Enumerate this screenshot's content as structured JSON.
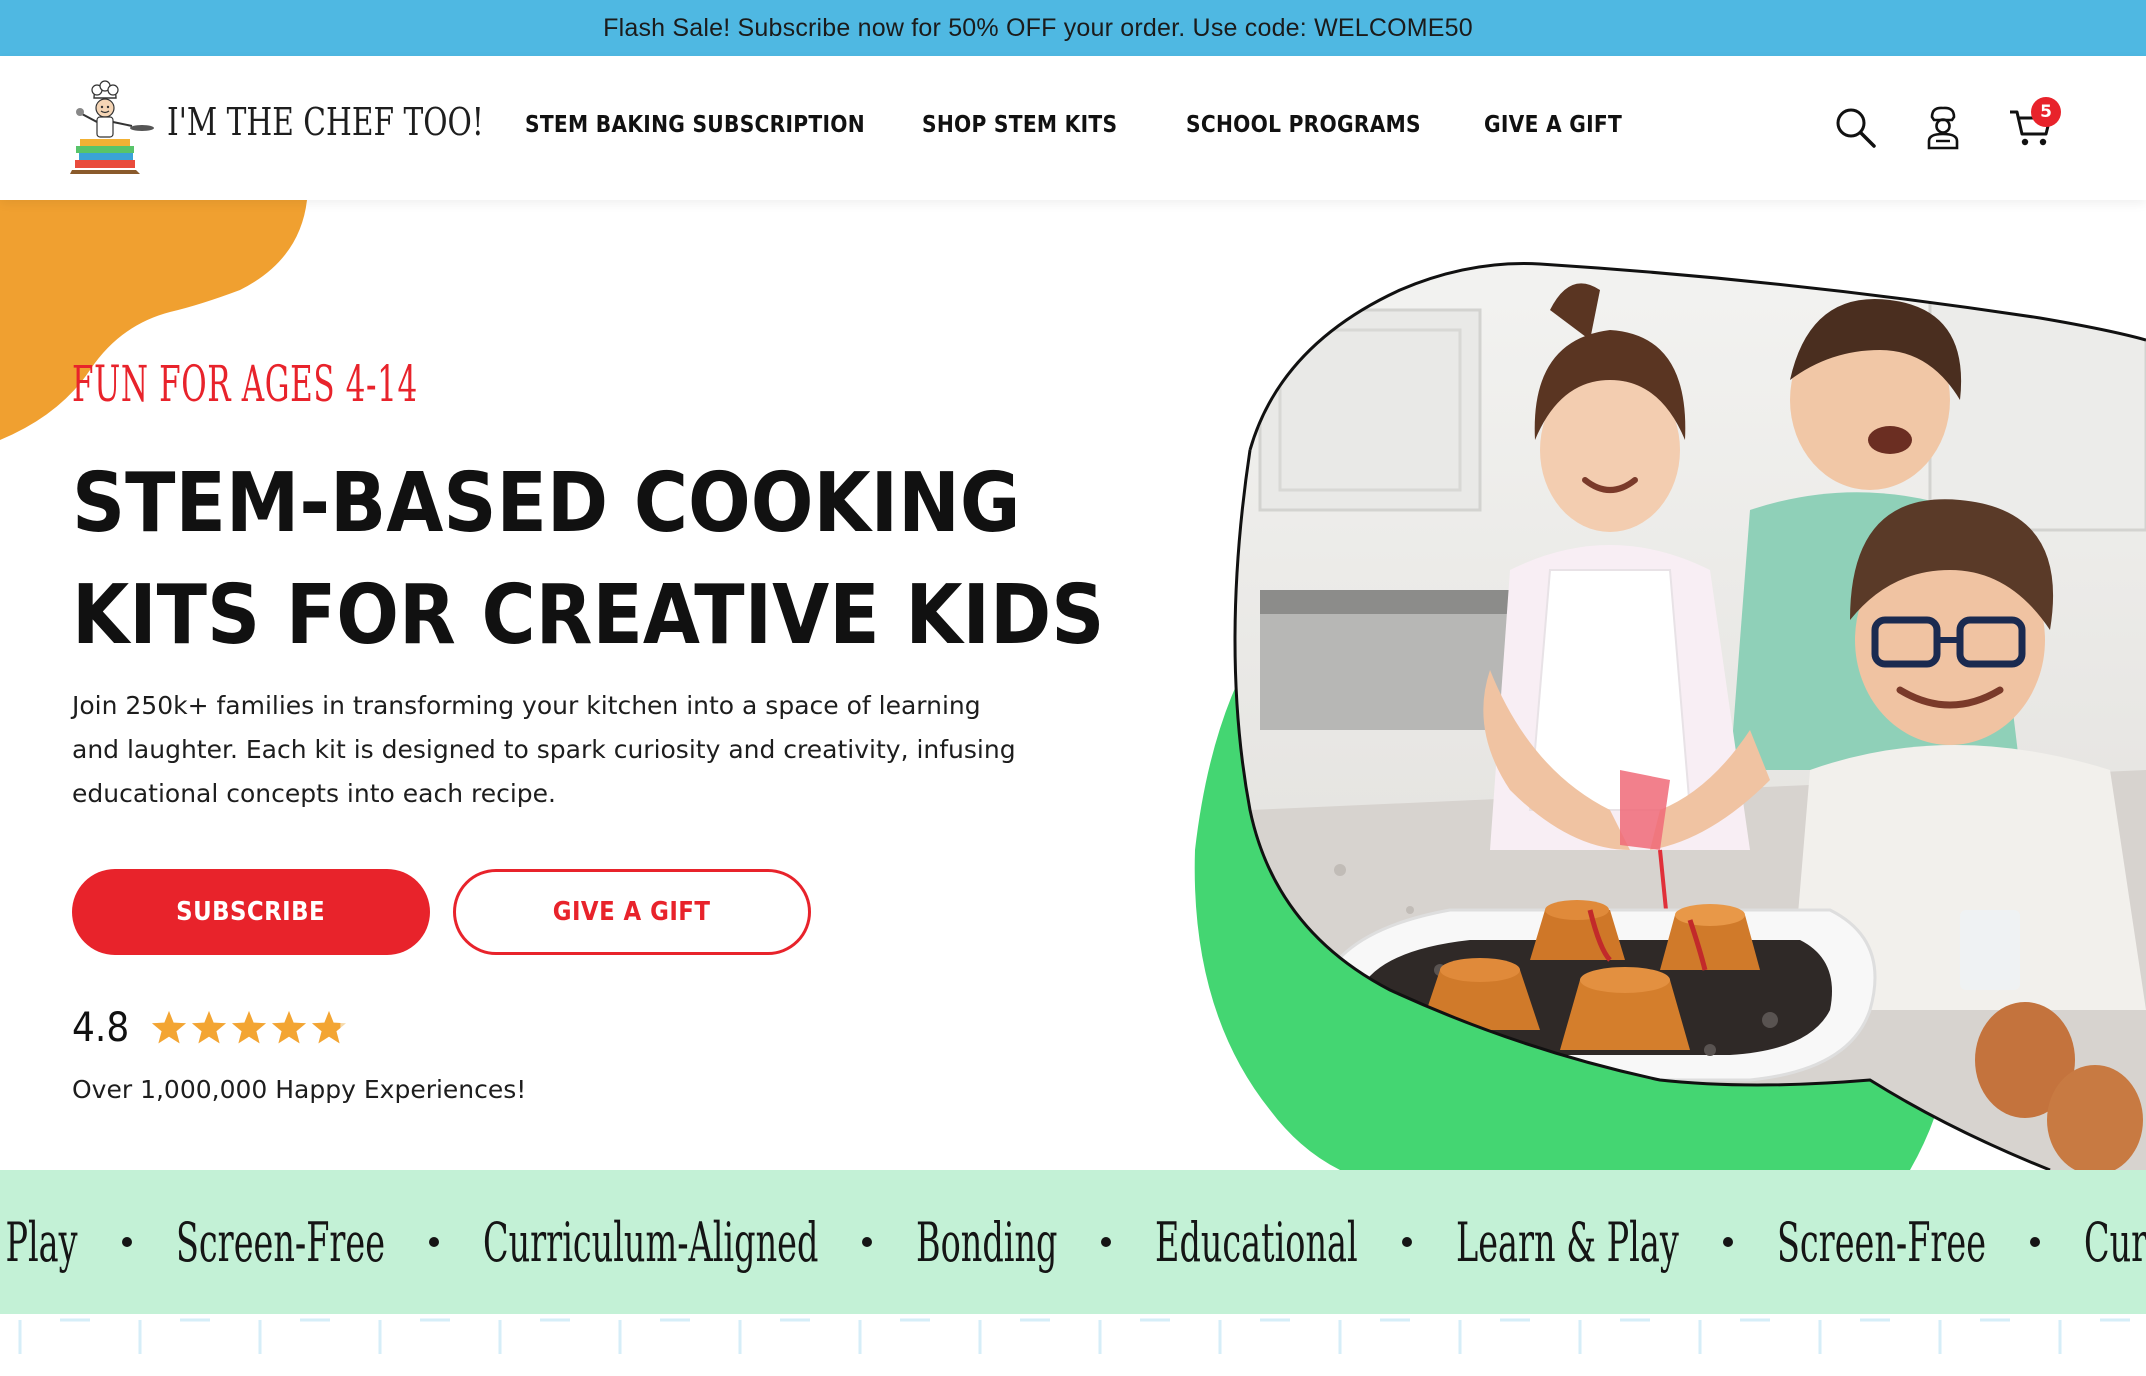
{
  "promo": {
    "text": "Flash Sale! Subscribe now for 50% OFF your order. Use code: WELCOME50"
  },
  "header": {
    "logo_text": "I'M THE CHEF TOO!",
    "logo_icon": "chef-mascot-logo",
    "nav": [
      {
        "label": "STEM BAKING SUBSCRIPTION"
      },
      {
        "label": "SHOP STEM KITS"
      },
      {
        "label": "SCHOOL PROGRAMS"
      },
      {
        "label": "GIVE A GIFT"
      }
    ],
    "icons": [
      "search-icon",
      "account-chef-icon",
      "cart-icon"
    ],
    "cart_count": "5"
  },
  "hero": {
    "eyebrow": "FUN FOR AGES 4-14",
    "title_line1": "STEM-BASED COOKING",
    "title_line2": "KITS FOR CREATIVE KIDS",
    "description": "Join 250k+ families in transforming your kitchen into a space of learning and laughter. Each kit is designed to spark curiosity and creativity, infusing educational concepts into each recipe.",
    "subscribe_label": "SUBSCRIBE",
    "gift_label": "GIVE A GIFT",
    "rating_value": "4.8",
    "rating_stars": 4.8,
    "rating_max": 5,
    "happy_text": "Over 1,000,000 Happy Experiences!"
  },
  "marquee": {
    "items": [
      "& Play",
      "Screen-Free",
      "Curriculum-Aligned",
      "Bonding",
      "Educational",
      "Learn & Play",
      "Screen-Free",
      "Curriculum-Aligned"
    ]
  },
  "colors": {
    "promo_bg": "#4fb8e2",
    "brand_red": "#e8232b",
    "orange_blob": "#f0a030",
    "green_blob": "#44d672",
    "marquee_bg": "#c3f1d6",
    "star": "#f3a533"
  }
}
